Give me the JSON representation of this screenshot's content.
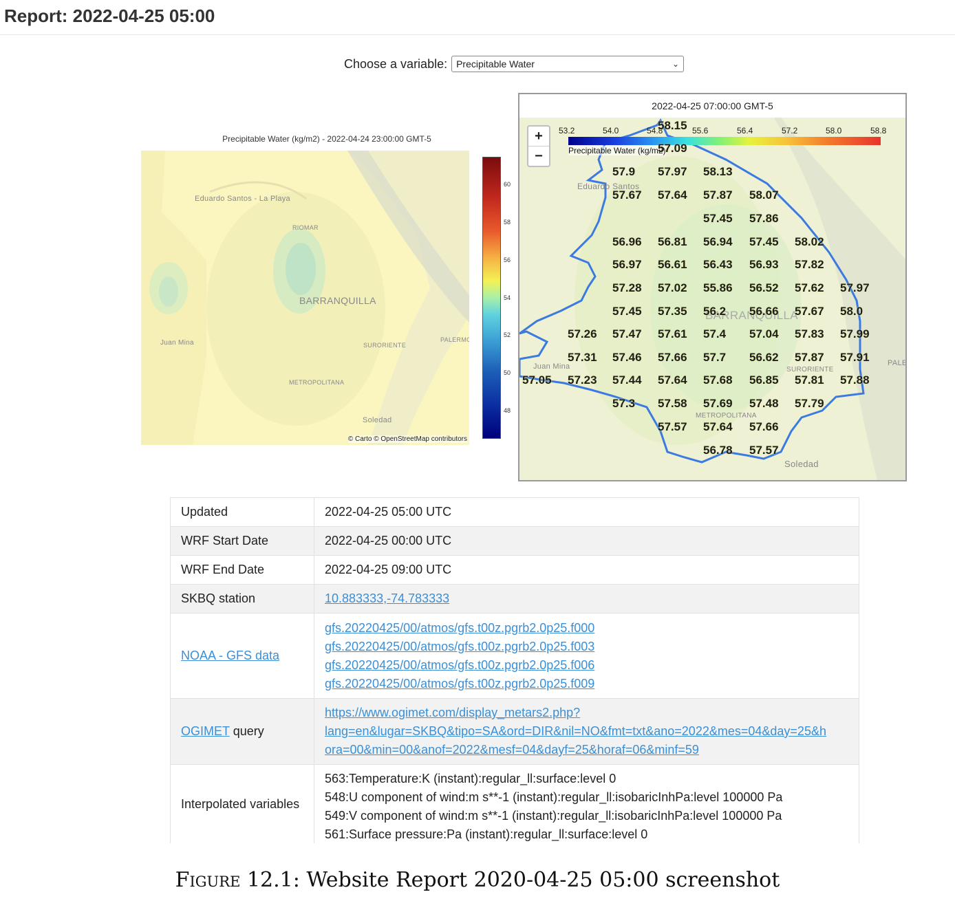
{
  "page_title": "Report: 2022-04-25 05:00",
  "variable": {
    "label": "Choose a variable:",
    "selected": "Precipitable Water"
  },
  "left_map": {
    "title": "Precipitable Water (kg/m2) - 2022-04-24 23:00:00 GMT-5",
    "attribution": "© Carto © OpenStreetMap contributors",
    "places": [
      "Eduardo Santos\n- La Playa",
      "RIOMAR",
      "BARRANQUILLA",
      "Juan Mina",
      "SURORIENTE",
      "PALERMO",
      "METROPOLITANA",
      "Soledad"
    ],
    "colorbar_ticks": [
      "60",
      "58",
      "56",
      "54",
      "52",
      "50",
      "48"
    ]
  },
  "right_map": {
    "title": "2022-04-25 07:00:00 GMT-5",
    "zoom_in": "+",
    "zoom_out": "−",
    "legend_ticks": [
      "53.2",
      "54.0",
      "54.8",
      "55.6",
      "56.4",
      "57.2",
      "58.0",
      "58.8"
    ],
    "legend_label": "Precipitable Water (kg/m2)",
    "places": [
      "Eduardo Santos",
      "BARRANQUILLA",
      "Juan Mina",
      "SURORIENTE",
      "PALER",
      "METROPOLITANA",
      "Soledad"
    ],
    "values": [
      [
        "58.15"
      ],
      [
        "57.09"
      ],
      [
        "57.9",
        "57.97",
        "58.13"
      ],
      [
        "57.67",
        "57.64",
        "57.87",
        "58.07"
      ],
      [
        "57.45",
        "57.86"
      ],
      [
        "56.96",
        "56.81",
        "56.94",
        "57.45",
        "58.02"
      ],
      [
        "56.97",
        "56.61",
        "56.43",
        "56.93",
        "57.82"
      ],
      [
        "57.28",
        "57.02",
        "55.86",
        "56.52",
        "57.62",
        "57.97"
      ],
      [
        "57.45",
        "57.35",
        "56.2",
        "56.66",
        "57.67",
        "58.0"
      ],
      [
        "57.26",
        "57.47",
        "57.61",
        "57.4",
        "57.04",
        "57.83",
        "57.99"
      ],
      [
        "57.31",
        "57.46",
        "57.66",
        "57.7",
        "56.62",
        "57.87",
        "57.91"
      ],
      [
        "57.05",
        "57.23",
        "57.44",
        "57.64",
        "57.68",
        "56.85",
        "57.81",
        "57.88"
      ],
      [
        "57.3",
        "57.58",
        "57.69",
        "57.48",
        "57.79"
      ],
      [
        "57.57",
        "57.64",
        "57.66"
      ],
      [
        "56.78",
        "57.57"
      ]
    ]
  },
  "table": {
    "updated": {
      "key": "Updated",
      "value": "2022-04-25 05:00 UTC"
    },
    "start": {
      "key": "WRF Start Date",
      "value": "2022-04-25 00:00 UTC"
    },
    "end": {
      "key": "WRF End Date",
      "value": "2022-04-25 09:00 UTC"
    },
    "station": {
      "key": "SKBQ station",
      "value": "10.883333,-74.783333"
    },
    "noaa": {
      "key": "NOAA - GFS data",
      "files": [
        "gfs.20220425/00/atmos/gfs.t00z.pgrb2.0p25.f000",
        "gfs.20220425/00/atmos/gfs.t00z.pgrb2.0p25.f003",
        "gfs.20220425/00/atmos/gfs.t00z.pgrb2.0p25.f006",
        "gfs.20220425/00/atmos/gfs.t00z.pgrb2.0p25.f009"
      ]
    },
    "ogimet": {
      "key_link": "OGIMET",
      "key_rest": " query",
      "lines": [
        "https://www.ogimet.com/display_metars2.php?",
        "lang=en&lugar=SKBQ&tipo=SA&ord=DIR&nil=NO&fmt=txt&ano=2022&mes=04&day=25&h",
        "ora=00&min=00&anof=2022&mesf=04&dayf=25&horaf=06&minf=59"
      ]
    },
    "interp": {
      "key": "Interpolated variables",
      "lines": [
        "563:Temperature:K (instant):regular_ll:surface:level 0",
        "548:U component of wind:m s**-1 (instant):regular_ll:isobaricInhPa:level 100000 Pa",
        "549:V component of wind:m s**-1 (instant):regular_ll:isobaricInhPa:level 100000 Pa",
        "561:Surface pressure:Pa (instant):regular_ll:surface:level 0"
      ]
    }
  },
  "caption": {
    "prefix": "Figure",
    "rest": " 12.1: Website Report 2020-04-25 05:00 screenshot"
  }
}
